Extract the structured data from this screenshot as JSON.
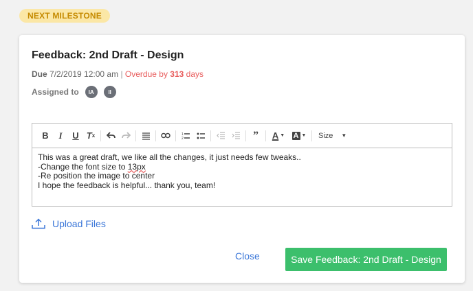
{
  "badge": {
    "label": "NEXT MILESTONE"
  },
  "card": {
    "title": "Feedback: 2nd Draft - Design",
    "due": {
      "label": "Due",
      "datetime": "7/2/2019 12:00 am",
      "separator": "|",
      "overdue_prefix": "Overdue by",
      "overdue_days": "313",
      "overdue_suffix": "days"
    },
    "assigned": {
      "label": "Assigned to",
      "avatars": [
        "IA",
        "II"
      ]
    },
    "editor": {
      "toolbar": {
        "size_label": "Size"
      },
      "lines": [
        "This was a great draft, we like all the changes, it just needs few tweaks..",
        "-Change the font size to ",
        "13px",
        "-Re position the image to center",
        "I hope the feedback is helpful... thank you, team!"
      ]
    },
    "upload_label": "Upload Files",
    "close_label": "Close",
    "save_label": "Save Feedback: 2nd Draft - Design"
  },
  "colors": {
    "accent": "#3a76d8",
    "save_green": "#3cbf6c",
    "overdue_red": "#e85c5c",
    "badge_bg": "#fbe7a6",
    "badge_text": "#c58a00"
  }
}
